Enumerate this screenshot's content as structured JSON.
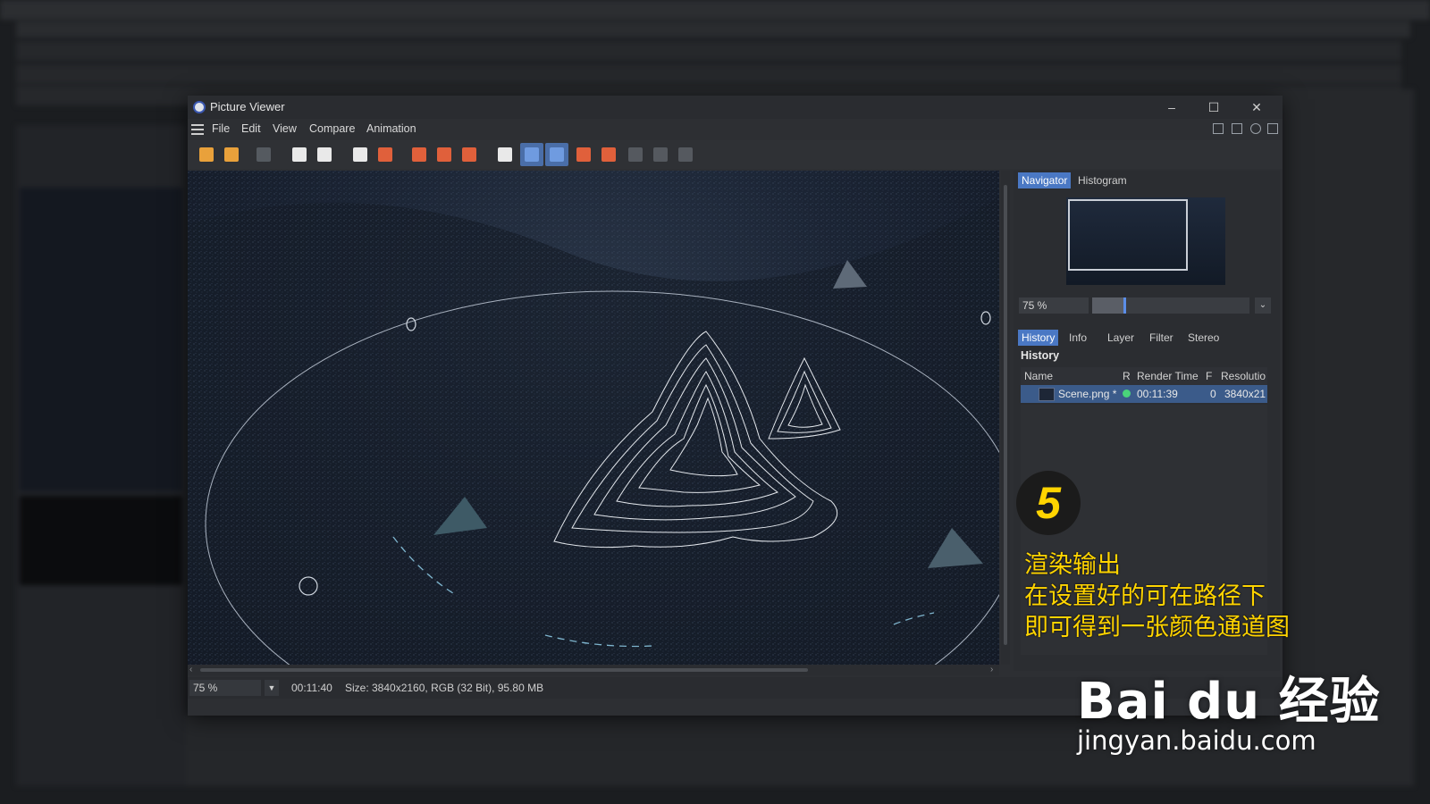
{
  "window": {
    "title": "Picture Viewer",
    "minimize": "–",
    "maximize": "☐",
    "close": "✕"
  },
  "menu": [
    "File",
    "Edit",
    "View",
    "Compare",
    "Animation"
  ],
  "toolbar_icons": [
    {
      "name": "open-icon",
      "color": "#e9a13b"
    },
    {
      "name": "save-icon",
      "color": "#e9a13b"
    },
    {
      "name": "stop-render-icon",
      "color": "#555a60"
    },
    {
      "name": "ab-compare-setup-icon",
      "color": "#e9e9e9"
    },
    {
      "name": "render-icon",
      "color": "#e9e9e9"
    },
    {
      "name": "copy-icon",
      "color": "#e9e9e9"
    },
    {
      "name": "layers-icon",
      "color": "#e0603b"
    },
    {
      "name": "view-mode-1-icon",
      "color": "#e0603b"
    },
    {
      "name": "view-mode-2-icon",
      "color": "#e0603b"
    },
    {
      "name": "view-mode-3-icon",
      "color": "#e0603b"
    },
    {
      "name": "text-ab-icon",
      "color": "#e9e9e9"
    },
    {
      "name": "split-vertical-icon",
      "color": "#6f9be0"
    },
    {
      "name": "split-horizontal-icon",
      "color": "#6f9be0"
    },
    {
      "name": "set-a-icon",
      "color": "#e0603b"
    },
    {
      "name": "set-b-icon",
      "color": "#e0603b"
    },
    {
      "name": "compare-off-1-icon",
      "color": "#55595f"
    },
    {
      "name": "compare-off-2-icon",
      "color": "#55595f"
    },
    {
      "name": "compare-off-3-icon",
      "color": "#55595f"
    }
  ],
  "navigator": {
    "tabs": [
      "Navigator",
      "Histogram"
    ],
    "active_tab": "Navigator",
    "zoom": "75 %",
    "zoom_level": 0.2
  },
  "panel_tabs": [
    "History",
    "Info",
    "Layer",
    "Filter",
    "Stereo"
  ],
  "history": {
    "label": "History",
    "columns": [
      "Name",
      "R",
      "Render Time",
      "F",
      "Resolutio"
    ],
    "rows": [
      {
        "name": "Scene.png *",
        "status_color": "#4ad37a",
        "render_time": "00:11:39",
        "frame": "0",
        "resolution": "3840x21"
      }
    ]
  },
  "status": {
    "zoom": "75 %",
    "time": "00:11:40",
    "size": "Size: 3840x2160, RGB (32 Bit), 95.80 MB"
  },
  "overlay": {
    "step": "5",
    "lines": [
      "渲染输出",
      "在设置好的可在路径下",
      "即可得到一张颜色通道图"
    ],
    "watermark": "Bai du 经验",
    "watermark_url": "jingyan.baidu.com"
  }
}
